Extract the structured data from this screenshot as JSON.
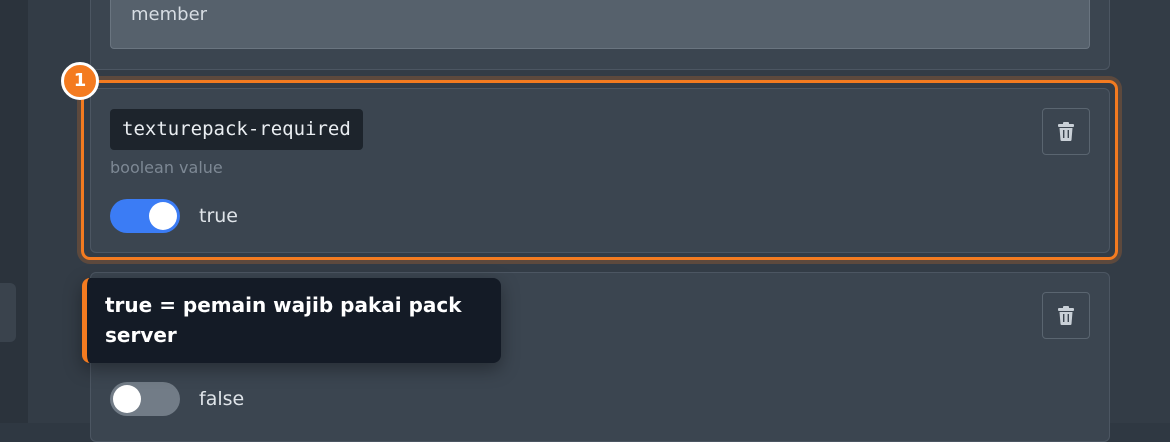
{
  "previous_field": {
    "value": "member"
  },
  "field": {
    "key": "texturepack-required",
    "description": "boolean value",
    "toggle_state": "true",
    "step_number": "1"
  },
  "next_field": {
    "toggle_state": "false"
  },
  "tooltip": {
    "text": "true = pemain wajib pakai pack server"
  },
  "icons": {
    "delete": "trash-icon"
  },
  "colors": {
    "highlight": "#f47b20",
    "toggle_on": "#3b7cf5",
    "toggle_off": "#727c87",
    "tooltip_bg": "#141b26"
  }
}
